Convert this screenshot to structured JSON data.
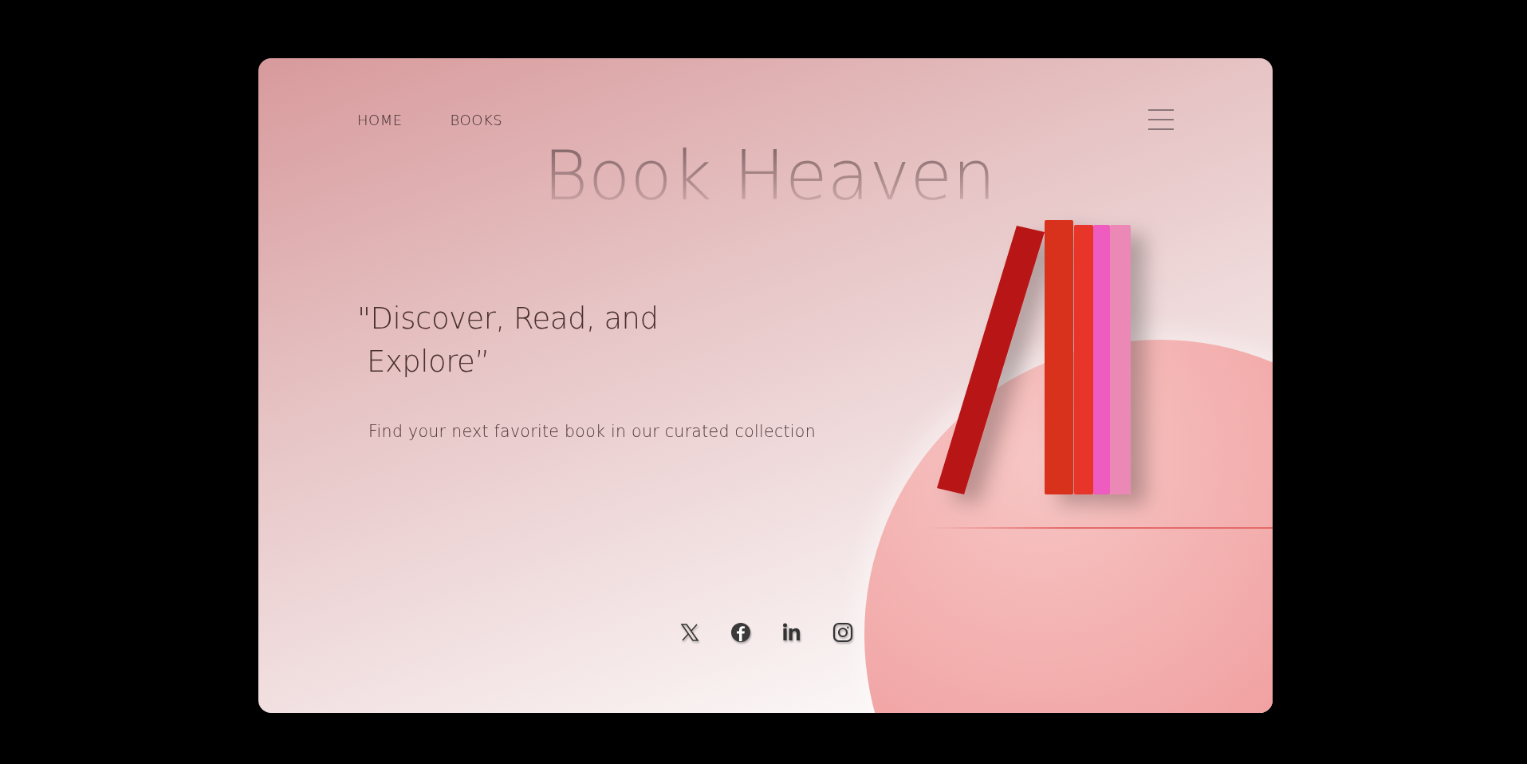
{
  "nav": {
    "links": [
      {
        "label": "HOME"
      },
      {
        "label": "BOOKS"
      }
    ]
  },
  "brand_title": "Book Heaven",
  "hero": {
    "headline_lines": [
      "\"Discover, Read, and",
      "Explore”"
    ],
    "subtitle": "Find your next favorite book in our curated collection"
  },
  "books": [
    {
      "color": "#b81414"
    },
    {
      "color": "#d8301c"
    },
    {
      "color": "#e8352a"
    },
    {
      "color": "#ee5cbf"
    },
    {
      "color": "#ec88b6"
    }
  ],
  "social_links": [
    {
      "kind": "x"
    },
    {
      "kind": "facebook"
    },
    {
      "kind": "linkedin"
    },
    {
      "kind": "instagram"
    }
  ]
}
